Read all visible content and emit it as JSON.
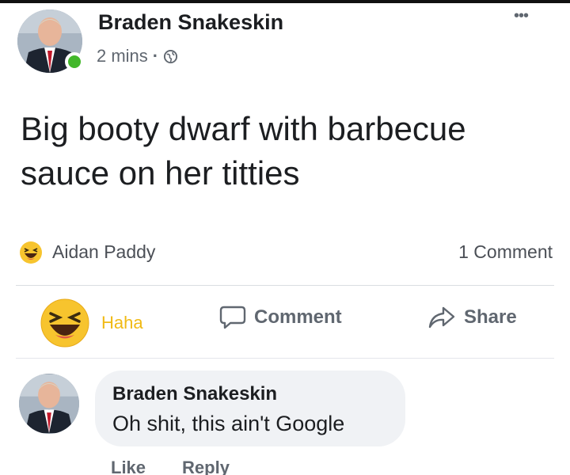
{
  "post": {
    "author": "Braden Snakeskin",
    "time": "2 mins",
    "separator": "·",
    "privacy_icon": "globe-icon",
    "more_icon": "more-options-icon",
    "more_symbol": "•••",
    "text": "Big booty dwarf with barbecue sauce on her titties"
  },
  "reactions": {
    "emoji": "haha-emoji",
    "reactor": "Aidan Paddy",
    "comment_count": "1 Comment"
  },
  "actions": {
    "haha_label": "Haha",
    "comment_label": "Comment",
    "share_label": "Share"
  },
  "comment": {
    "author": "Braden Snakeskin",
    "text": "Oh shit, this ain't Google",
    "like_label": "Like",
    "reply_label": "Reply"
  },
  "colors": {
    "online": "#42b72a",
    "haha_yellow": "#f0ba15",
    "secondary_text": "#606770",
    "bubble": "#f0f2f5"
  }
}
